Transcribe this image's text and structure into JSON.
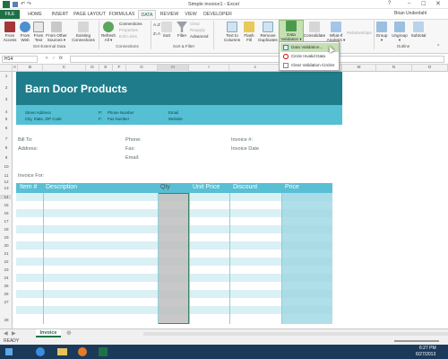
{
  "window": {
    "title": "Simple invoice1 - Excel",
    "user": "Brian Underdahl"
  },
  "tabs": [
    "FILE",
    "HOME",
    "INSERT",
    "PAGE LAYOUT",
    "FORMULAS",
    "DATA",
    "REVIEW",
    "VIEW",
    "DEVELOPER"
  ],
  "active_tab": "DATA",
  "ribbon": {
    "buttons": [
      {
        "line1": "From",
        "line2": "Access"
      },
      {
        "line1": "From",
        "line2": "Web"
      },
      {
        "line1": "From",
        "line2": "Text"
      },
      {
        "line1": "From Other",
        "line2": "Sources ▾"
      },
      {
        "line1": "Existing",
        "line2": "Connections"
      },
      {
        "line1": "Refresh",
        "line2": "All ▾"
      },
      {
        "line1": "Sort",
        "line2": ""
      },
      {
        "line1": "Filter",
        "line2": ""
      },
      {
        "line1": "Text to",
        "line2": "Columns"
      },
      {
        "line1": "Flash",
        "line2": "Fill"
      },
      {
        "line1": "Remove",
        "line2": "Duplicates"
      },
      {
        "line1": "Data",
        "line2": "Validation ▾"
      },
      {
        "line1": "Consolidate",
        "line2": ""
      },
      {
        "line1": "What-If",
        "line2": "Analysis ▾"
      },
      {
        "line1": "Relationships",
        "line2": ""
      },
      {
        "line1": "Group",
        "line2": "▾"
      },
      {
        "line1": "Ungroup",
        "line2": "▾"
      },
      {
        "line1": "Subtotal",
        "line2": ""
      }
    ],
    "small": [
      "Connections",
      "Properties",
      "Edit Links",
      "Clear",
      "Reapply",
      "Advanced"
    ],
    "groups": [
      "Get External Data",
      "Connections",
      "Sort & Filter",
      "Outline"
    ]
  },
  "formula_bar": {
    "name_box": "H14",
    "fx": "fx",
    "content": ""
  },
  "columns": [
    "A",
    "B",
    "C",
    "D",
    "E",
    "F",
    "G",
    "H",
    "I",
    "J",
    "K",
    "L",
    "M",
    "N",
    "O"
  ],
  "rows": [
    "1",
    "2",
    "3",
    "4",
    "5",
    "6",
    "7",
    "8",
    "9",
    "10",
    "11",
    "12",
    "13",
    "14",
    "15",
    "16",
    "17",
    "18",
    "19",
    "20",
    "21",
    "22",
    "23",
    "24",
    "25",
    "26",
    "27",
    "28"
  ],
  "invoice": {
    "company": "Barn Door Products",
    "street": "Street Address",
    "city": "City, State, ZIP Code",
    "phone_p": "P:",
    "phone": "Phone Number",
    "fax_f": "F:",
    "fax": "Fax Number",
    "email": "Email",
    "website": "Website",
    "bill_to": "Bill To:",
    "address": "Address:",
    "phone_lbl": "Phone:",
    "fax_lbl": "Fax:",
    "email_lbl": "Email:",
    "invoice_no": "Invoice #:",
    "invoice_date": "Invoice Date",
    "invoice_for": "Invoice For:",
    "headers": [
      "Item #",
      "Description",
      "Qty",
      "Unit Price",
      "Discount",
      "Price"
    ]
  },
  "dropdown": [
    "Data Validation...",
    "Circle Invalid Data",
    "Clear Validation Circles"
  ],
  "sheet_tab": "Invoice",
  "status": {
    "mode": "READY"
  },
  "taskbar": {
    "time": "6:27 PM",
    "date": "6/27/2013"
  }
}
